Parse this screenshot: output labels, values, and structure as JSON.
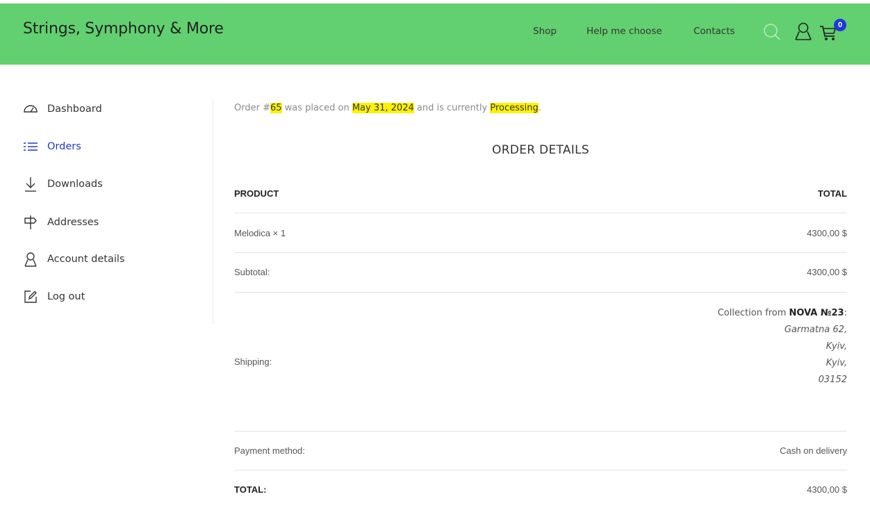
{
  "header": {
    "brand": "Strings, Symphony & More",
    "nav": [
      "Shop",
      "Help me choose",
      "Contacts"
    ],
    "cart_count": "0",
    "icons": [
      "search-icon",
      "user-icon",
      "cart-icon"
    ],
    "bg_color": "#62d070",
    "accent_color": "#1f37d8"
  },
  "sidebar": {
    "items": [
      {
        "label": "Dashboard",
        "icon": "dashboard-icon"
      },
      {
        "label": "Orders",
        "icon": "list-icon",
        "active": true
      },
      {
        "label": "Downloads",
        "icon": "download-icon"
      },
      {
        "label": "Addresses",
        "icon": "signpost-icon"
      },
      {
        "label": "Account details",
        "icon": "user-icon"
      },
      {
        "label": "Log out",
        "icon": "edit-icon"
      }
    ]
  },
  "notice": {
    "prefix": "Order #",
    "order_number": "65",
    "mid1": " was placed on ",
    "date": "May 31, 2024",
    "mid2": " and is currently ",
    "status": "Processing",
    "suffix": "."
  },
  "order": {
    "title": "ORDER DETAILS",
    "col_product": "PRODUCT",
    "col_total": "TOTAL",
    "items": [
      {
        "name": "Melodica × 1",
        "total": "4300,00 $"
      }
    ],
    "subtotal_label": "Subtotal:",
    "subtotal": "4300,00 $",
    "shipping_label": "Shipping:",
    "shipping": {
      "prefix": "Collection from ",
      "place": "NOVA №23",
      "suffix": ":",
      "address_lines": [
        "Garmatna 62,",
        "Kyiv,",
        "Kyiv,",
        "03152"
      ]
    },
    "payment_label": "Payment method:",
    "payment": "Cash on delivery",
    "total_label": "TOTAL:",
    "total": "4300,00 $"
  }
}
